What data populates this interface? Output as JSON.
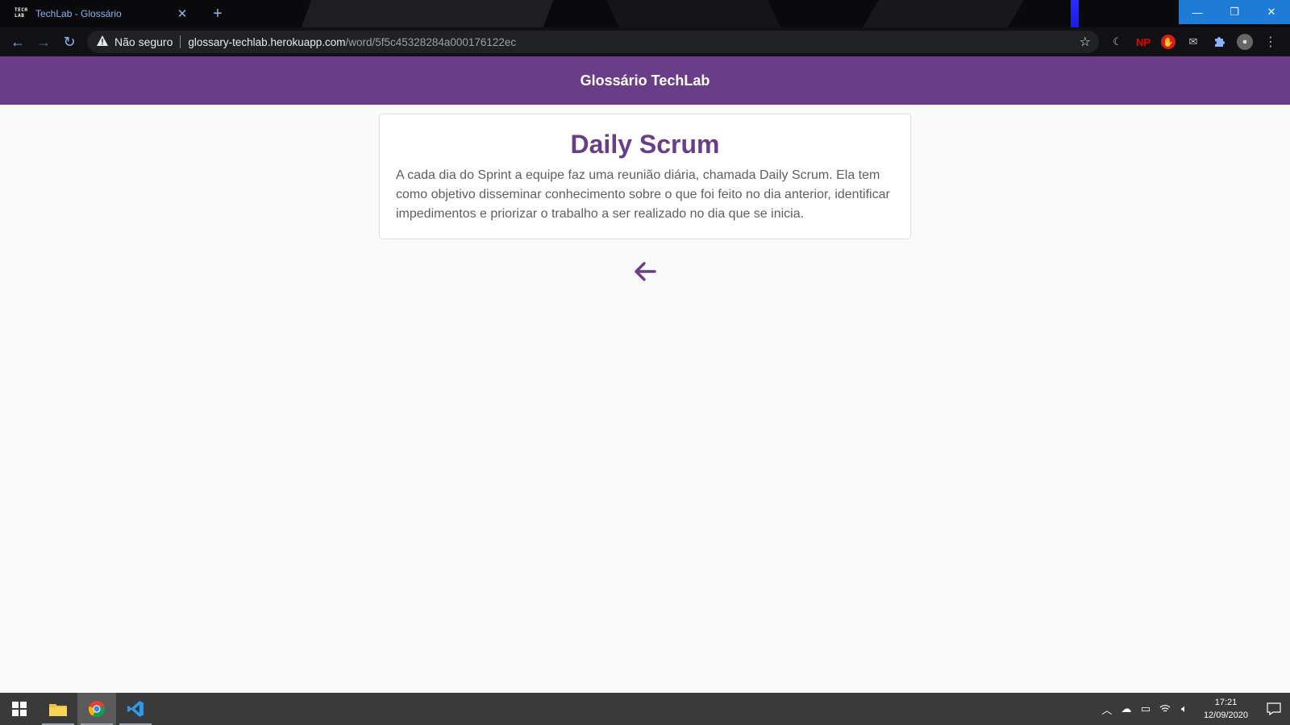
{
  "browser": {
    "tab": {
      "favicon_text": "TECH LAB",
      "title": "TechLab - Glossário",
      "close": "✕"
    },
    "new_tab": "+",
    "window_controls": {
      "minimize": "—",
      "restore": "❐",
      "close": "✕"
    },
    "nav": {
      "back": "←",
      "forward": "→",
      "reload": "↻"
    },
    "omnibox": {
      "security_label": "Não seguro",
      "url_host": "glossary-techlab.herokuapp.com",
      "url_path": "/word/5f5c45328284a000176122ec"
    },
    "extensions": {
      "np_label": "NP"
    }
  },
  "app": {
    "header_title": "Glossário TechLab",
    "accent_color": "#6a3d89"
  },
  "word": {
    "term": "Daily Scrum",
    "definition": "A cada dia do Sprint a equipe faz uma reunião diária, chamada Daily Scrum. Ela tem como objetivo disseminar conhecimento sobre o que foi feito no dia anterior, identificar impedimentos e priorizar o trabalho a ser realizado no dia que se inicia."
  },
  "back_button": {
    "icon": "arrow-left-icon"
  },
  "taskbar": {
    "clock_time": "17:21",
    "clock_date": "12/09/2020"
  }
}
